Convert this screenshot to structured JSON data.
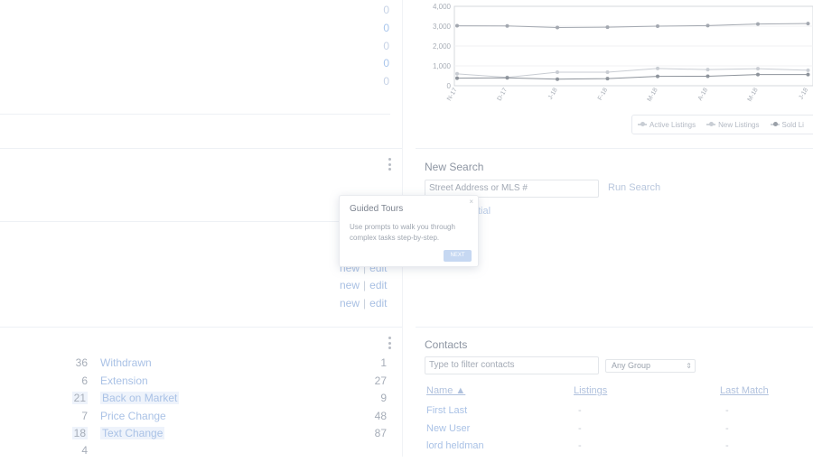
{
  "top_counts": [
    "0",
    "0",
    "0",
    "0",
    "0"
  ],
  "edit_links": [
    {
      "new": "new",
      "sep": "|",
      "edit": "edit"
    },
    {
      "new": "new",
      "sep": "|",
      "edit": "edit"
    },
    {
      "new": "new",
      "sep": "|",
      "edit": "edit"
    }
  ],
  "status_rows": [
    {
      "count": "36",
      "label": "Withdrawn",
      "value": "1"
    },
    {
      "count": "6",
      "label": "Extension",
      "value": "27"
    },
    {
      "count": "21",
      "label": "Back on Market",
      "value": "9"
    },
    {
      "count": "7",
      "label": "Price Change",
      "value": "48"
    },
    {
      "count": "18",
      "label": "Text Change",
      "value": "87"
    },
    {
      "count": "4",
      "label": "",
      "value": ""
    }
  ],
  "chart_data": {
    "type": "line",
    "categories": [
      "N-17",
      "D-17",
      "J-18",
      "F-18",
      "M-18",
      "A-18",
      "M-18",
      "J-18"
    ],
    "ylim": [
      0,
      4000
    ],
    "yticks": [
      "4,000",
      "3,000",
      "2,000",
      "1,000",
      "0"
    ],
    "series": [
      {
        "name": "Active Listings",
        "values": [
          3020,
          3010,
          2930,
          2950,
          3000,
          3030,
          3110,
          3130
        ]
      },
      {
        "name": "New Listings",
        "values": [
          600,
          420,
          680,
          680,
          870,
          810,
          860,
          780
        ]
      },
      {
        "name": "Sold Li",
        "values": [
          380,
          400,
          330,
          360,
          470,
          480,
          560,
          560
        ]
      }
    ],
    "legend_position": "bottom-right"
  },
  "new_search": {
    "title": "New Search",
    "placeholder": "Street Address or MLS #",
    "run_label": "Run Search",
    "partial_text": "tial"
  },
  "tour": {
    "title": "Guided Tours",
    "description": "Use prompts to walk you through complex tasks step-by-step.",
    "next_label": "NEXT",
    "close": "×"
  },
  "contacts": {
    "title": "Contacts",
    "filter_placeholder": "Type to filter contacts",
    "group_select": "Any Group",
    "columns": [
      "Name ▲",
      "Listings",
      "Last Match"
    ],
    "rows": [
      {
        "name": "First Last",
        "listings": "-",
        "last_match": "-"
      },
      {
        "name": "New User",
        "listings": "-",
        "last_match": "-"
      },
      {
        "name": "lord heldman",
        "listings": "-",
        "last_match": "-"
      }
    ]
  }
}
